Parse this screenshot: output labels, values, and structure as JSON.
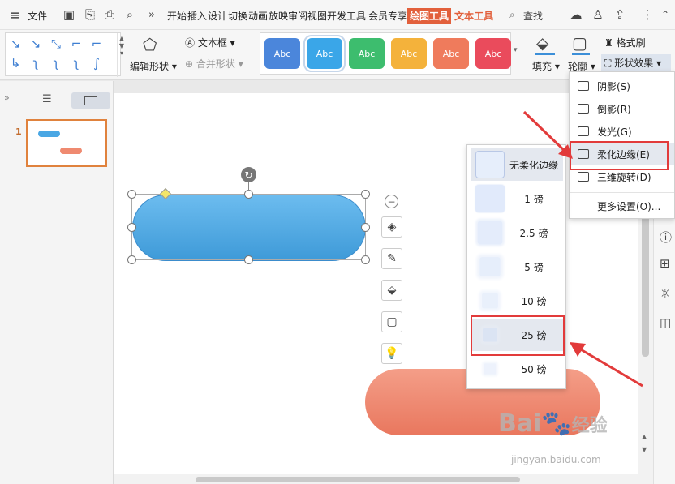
{
  "menu": {
    "file": "文件",
    "tabs": [
      "开始",
      "插入",
      "设计",
      "切换",
      "动画",
      "放映",
      "审阅",
      "视图",
      "开发工具",
      "会员专享"
    ],
    "drawing_tools": "绘图工具",
    "text_tools": "文本工具",
    "search": "查找"
  },
  "ribbon": {
    "edit_shape": "编辑形状",
    "text_box": "文本框",
    "merge_shape": "合并形状",
    "style_label": "Abc",
    "fill": "填充",
    "outline": "轮廓",
    "format_painter": "格式刷",
    "shape_effects": "形状效果"
  },
  "style_colors": [
    "#4b86db",
    "#3aa6e8",
    "#3dbd6e",
    "#f4b23b",
    "#ef7b5c",
    "#ea4b5c"
  ],
  "slides": {
    "number": "1"
  },
  "effect_menu": {
    "items": [
      "阴影(S)",
      "倒影(R)",
      "发光(G)",
      "柔化边缘(E)",
      "三维旋转(D)"
    ],
    "more": "更多设置(O)..."
  },
  "soft_edge_menu": {
    "items": [
      "无柔化边缘",
      "1 磅",
      "2.5 磅",
      "5 磅",
      "10 磅",
      "25 磅",
      "50 磅"
    ]
  },
  "watermark": {
    "brand": "Bai",
    "brand_mid": "经验",
    "url": "jingyan.baidu.com"
  }
}
